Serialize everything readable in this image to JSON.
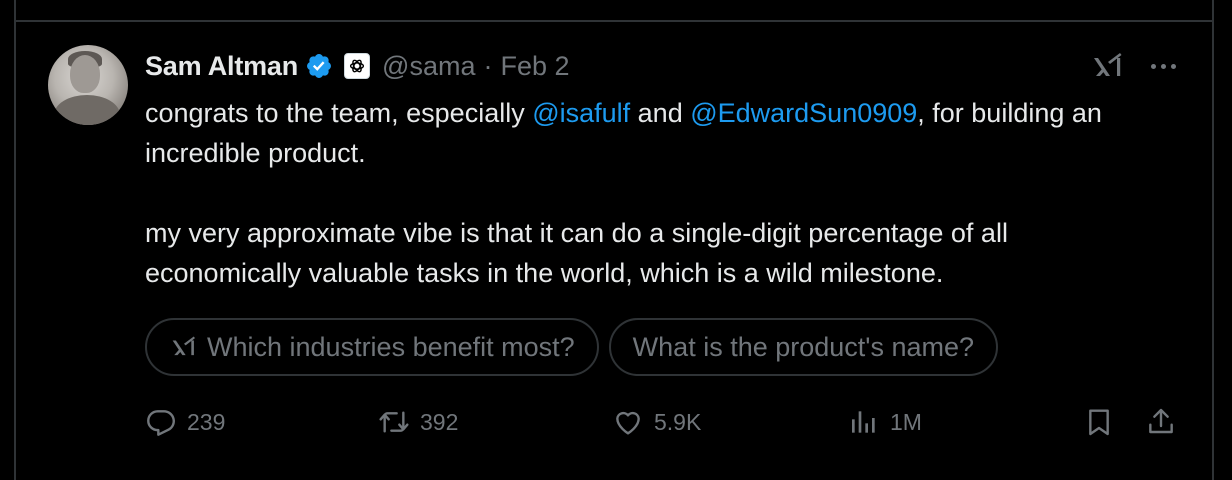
{
  "author": {
    "display_name": "Sam Altman",
    "handle": "@sama",
    "separator": "·",
    "date": "Feb 2",
    "verified_icon": "verified-badge-icon",
    "affiliation_icon": "openai-logo-icon"
  },
  "tweet": {
    "para1_pre": "congrats to the team, especially ",
    "mention1": "@isafulf",
    "para1_mid": " and ",
    "mention2": "@EdwardSun0909",
    "para1_post": ", for building an incredible product.",
    "para2": "my very approximate vibe is that it can do a single-digit percentage of all economically valuable tasks in the world, which is a wild milestone."
  },
  "suggestions": [
    {
      "label": "Which industries benefit most?",
      "icon": "grok-icon"
    },
    {
      "label": "What is the product's name?"
    }
  ],
  "actions": {
    "replies": "239",
    "reposts": "392",
    "likes": "5.9K",
    "views": "1M"
  },
  "colors": {
    "background": "#000000",
    "text": "#e7e9ea",
    "muted": "#71767b",
    "link": "#1d9bf0",
    "border": "#2f3336",
    "verified": "#1d9bf0"
  }
}
